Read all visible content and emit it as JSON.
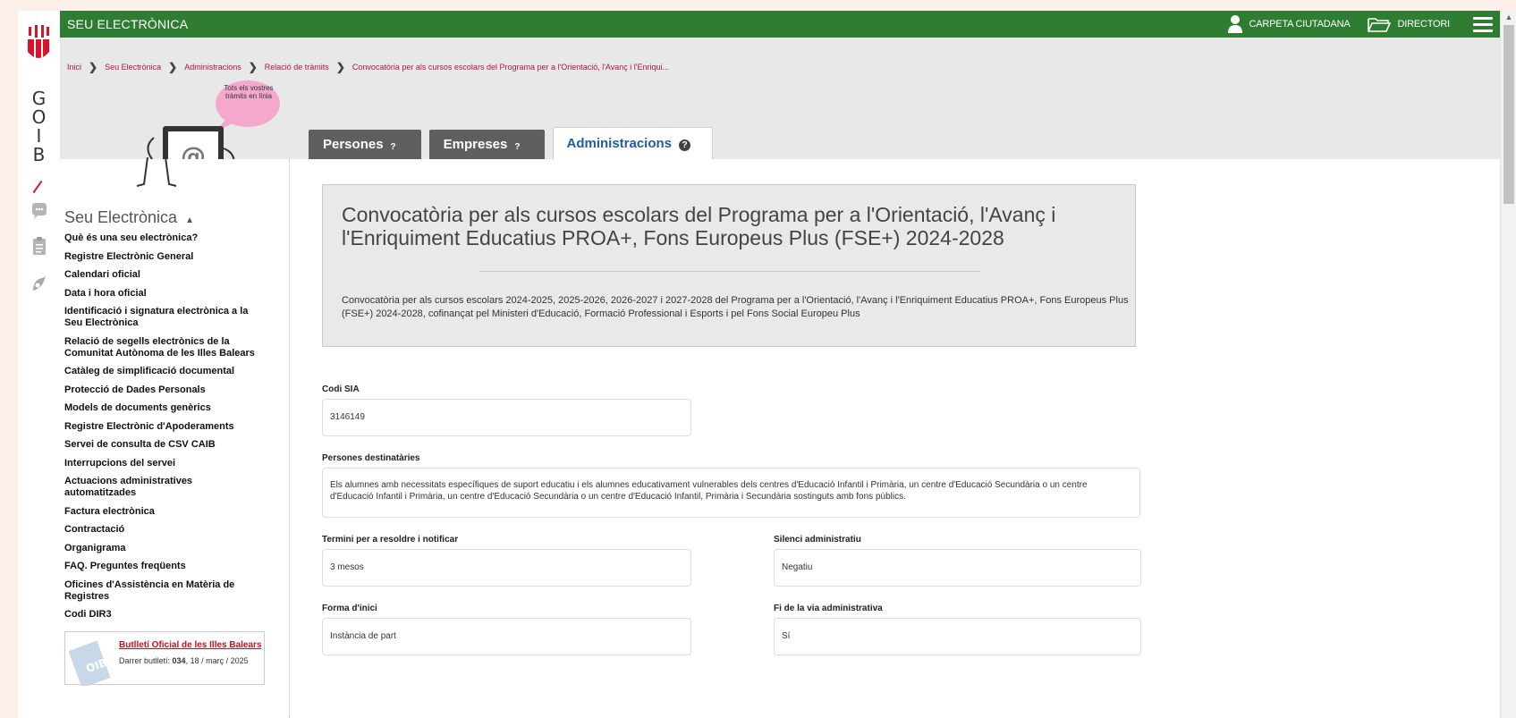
{
  "gov": {
    "letters": [
      "G",
      "O",
      "I",
      "B"
    ]
  },
  "topbar": {
    "title": "SEU ELECTRÒNICA",
    "carpeta": "CARPETA CIUTADANA",
    "directori": "DIRECTORI"
  },
  "breadcrumb": [
    "Inici",
    "Seu Electrònica",
    "Administracions",
    "Relació de tràmits",
    "Convocatòria per als cursos escolars del Programa per a l'Orientació, l'Avanç i l'Enriqui..."
  ],
  "bubble": "Tots els vostres tràmits en línia",
  "tabs": [
    {
      "label": "Persones",
      "help": "?"
    },
    {
      "label": "Empreses",
      "help": "?"
    },
    {
      "label": "Administracions",
      "help": "?"
    }
  ],
  "sidebar": {
    "title": "Seu Electrònica",
    "items": [
      "Què és una seu electrònica?",
      "Registre Electrònic General",
      "Calendari oficial",
      "Data i hora oficial",
      "Identificació i signatura electrònica a la Seu Electrònica",
      "Relació de segells electrònics de la Comunitat Autònoma de les Illes Balears",
      "Catàleg de simplificació documental",
      "Protecció de Dades Personals",
      "Models de documents genèrics",
      "Registre Electrònic d'Apoderaments",
      "Servei de consulta de CSV CAIB",
      "Interrupcions del servei",
      "Actuacions administratives automatitzades",
      "Factura electrònica",
      "Contractació",
      "Organigrama",
      "FAQ. Preguntes freqüents",
      "Oficines d'Assistència en Matèria de Registres",
      "Codi DIR3"
    ],
    "boib": {
      "title": "Butlletí Oficial de les Illes Balears",
      "latest_prefix": "Darrer butlletí:",
      "latest_number": "034",
      "latest_date": ", 18 / març / 2025"
    }
  },
  "main": {
    "title": "Convocatòria per als cursos escolars del Programa per a l'Orientació, l'Avanç i l'Enriquiment Educatius PROA+, Fons Europeus Plus (FSE+) 2024-2028",
    "description": "Convocatòria per als cursos escolars 2024-2025, 2025-2026, 2026-2027 i 2027-2028 del Programa per a l'Orientació, l'Avanç i l'Enriquiment Educatius PROA+, Fons Europeus Plus (FSE+) 2024-2028, cofinançat pel Ministeri d'Educació, Formació Professional i Esports i pel Fons Social Europeu Plus",
    "fields": {
      "codi_sia": {
        "label": "Codi SIA",
        "value": "3146149"
      },
      "destinataries": {
        "label": "Persones destinatàries",
        "value": "Els alumnes amb necessitats específiques de suport educatiu i els alumnes educativament vulnerables dels centres d'Educació Infantil i Primària, un centre d'Educació Secundària o un centre d'Educació Infantil i Primària, un centre d'Educació Secundària o un centre d'Educació Infantil, Primària i Secundària sostinguts amb fons públics."
      },
      "termini": {
        "label": "Termini per a resoldre i notificar",
        "value": "3 mesos"
      },
      "silenci": {
        "label": "Silenci administratiu",
        "value": "Negatiu"
      },
      "forma": {
        "label": "Forma d'inici",
        "value": "Instància de part"
      },
      "fi_via": {
        "label": "Fi de la via administrativa",
        "value": "Sí"
      }
    }
  }
}
